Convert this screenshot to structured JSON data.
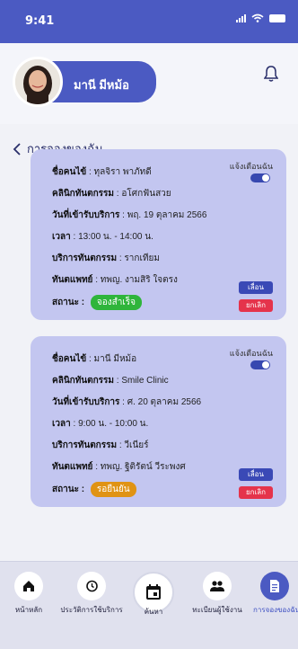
{
  "status_bar": {
    "time": "9:41"
  },
  "profile": {
    "name": "มานี มีหม้อ"
  },
  "page": {
    "back_title": "การจองของฉัน"
  },
  "labels": {
    "patient": "ชื่อคนไข้",
    "clinic": "คลินิกทันตกรรม",
    "date": "วันที่เข้ารับบริการ",
    "time": "เวลา",
    "service": "บริการทันตกรรม",
    "dentist": "ทันตแพทย์",
    "status": "สถานะ :",
    "notify": "แจ้งเตือนฉัน",
    "postpone": "เลื่อน",
    "cancel": "ยกเลิก"
  },
  "bookings": [
    {
      "patient": "ทุลจิรา  พาภัทดี",
      "clinic": "อโศกฟันสวย",
      "date": "พฤ. 19 ตุลาคม 2566",
      "time": "13:00 น. - 14:00 น.",
      "service": "รากเทียม",
      "dentist": "ทพญ. งามสิริ ใจตรง",
      "status": "จองสำเร็จ",
      "status_color": "#2fb53b",
      "notify_on": true
    },
    {
      "patient": "มานี  มีหม้อ",
      "clinic": "Smile Clinic",
      "date": "ศ. 20 ตุลาคม 2566",
      "time": "9:00 น. - 10:00 น.",
      "service": "วีเนียร์",
      "dentist": "ทพญ. ฐิติรัตน์  วีระพงศ",
      "status": "รอยืนยัน",
      "status_color": "#e09314",
      "notify_on": true
    }
  ],
  "bottom_nav": {
    "home": "หน้าหลัก",
    "history": "ประวัติการใช้บริการ",
    "search": "ค้นหา",
    "users": "ทะเบียนผู้ใช้งาน",
    "my_bookings": "การจองของฉัน"
  }
}
